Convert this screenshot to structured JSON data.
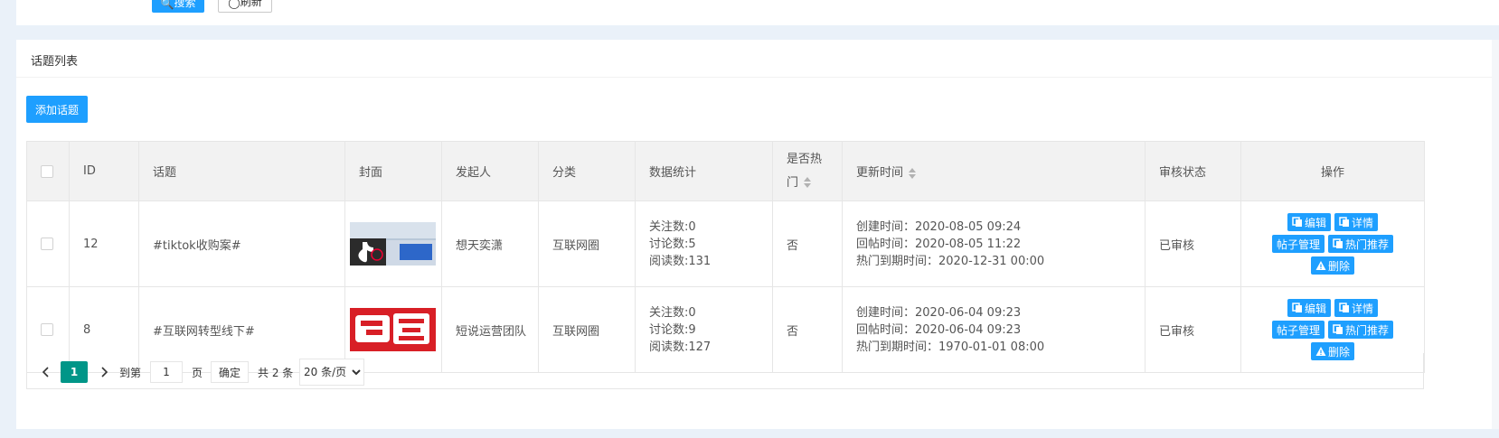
{
  "toolbar": {
    "search_label": "搜索",
    "refresh_label": "刷新"
  },
  "card": {
    "title": "话题列表",
    "add_label": "添加话题"
  },
  "table": {
    "headers": {
      "id": "ID",
      "topic": "话题",
      "cover": "封面",
      "author": "发起人",
      "category": "分类",
      "stats": "数据统计",
      "hot_line1": "是否热",
      "hot_line2": "门",
      "update_time": "更新时间",
      "review": "审核状态",
      "actions": "操作"
    },
    "rows": [
      {
        "id": "12",
        "topic": "#tiktok收购案#",
        "author": "想天奕潇",
        "category": "互联网圈",
        "follow": "关注数:0",
        "discuss": "讨论数:5",
        "read": "阅读数:131",
        "hot": "否",
        "created": "创建时间：2020-08-05 09:24",
        "replied": "回帖时间：2020-08-05 11:22",
        "hot_expire": "热门到期时间：2020-12-31 00:00",
        "review": "已审核"
      },
      {
        "id": "8",
        "topic": "#互联网转型线下#",
        "author": "短说运营团队",
        "category": "互联网圈",
        "follow": "关注数:0",
        "discuss": "讨论数:9",
        "read": "阅读数:127",
        "hot": "否",
        "created": "创建时间：2020-06-04 09:23",
        "replied": "回帖时间：2020-06-04 09:23",
        "hot_expire": "热门到期时间：1970-01-01 08:00",
        "review": "已审核"
      }
    ],
    "actions": {
      "edit": "编辑",
      "detail": "详情",
      "posts": "帖子管理",
      "recommend": "热门推荐",
      "delete": "删除"
    }
  },
  "pager": {
    "current": "1",
    "goto_label": "到第",
    "goto_value": "1",
    "page_unit": "页",
    "confirm_label": "确定",
    "total": "共 2 条",
    "page_size": "20 条/页"
  }
}
